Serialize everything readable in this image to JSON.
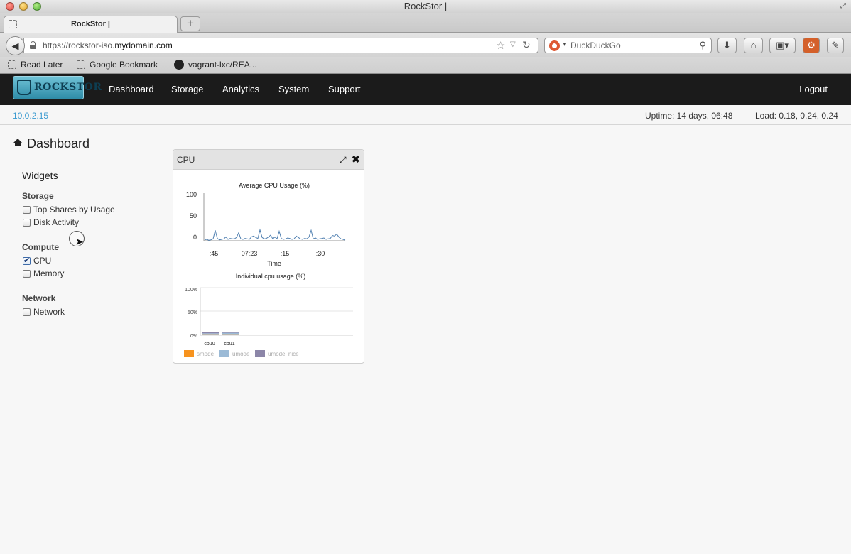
{
  "browser": {
    "window_title": "RockStor |",
    "tab_title": "RockStor |",
    "new_tab_label": "+",
    "url_prefix": "https://rockstor-iso.",
    "url_domain": "mydomain.com",
    "search_placeholder": "DuckDuckGo",
    "bookmarks": [
      "Read Later",
      "Google Bookmark",
      "vagrant-lxc/REA..."
    ]
  },
  "app": {
    "logo_text": "ROCKSTOR",
    "nav": [
      "Dashboard",
      "Storage",
      "Analytics",
      "System",
      "Support"
    ],
    "logout": "Logout",
    "ip": "10.0.2.15",
    "uptime": "Uptime: 14 days, 06:48",
    "load": "Load: 0.18, 0.24, 0.24"
  },
  "sidebar": {
    "title": "Dashboard",
    "widgets_heading": "Widgets",
    "groups": [
      {
        "name": "Storage",
        "items": [
          {
            "label": "Top Shares by Usage",
            "checked": false
          },
          {
            "label": "Disk Activity",
            "checked": false
          }
        ]
      },
      {
        "name": "Compute",
        "items": [
          {
            "label": "CPU",
            "checked": true
          },
          {
            "label": "Memory",
            "checked": false
          }
        ]
      },
      {
        "name": "Network",
        "items": [
          {
            "label": "Network",
            "checked": false
          }
        ]
      }
    ]
  },
  "widget": {
    "title": "CPU"
  },
  "colors": {
    "line": "#4f7fb0",
    "smode": "#f7931e",
    "umode": "#9bbad6",
    "umode_nice": "#8c86a8"
  },
  "chart_data": [
    {
      "type": "line",
      "title": "Average CPU Usage (%)",
      "xlabel": "Time",
      "ylabel": "",
      "ylim": [
        0,
        100
      ],
      "yticks": [
        "100",
        "50",
        "0"
      ],
      "x_ticks": [
        ":45",
        "07:23",
        ":15",
        ":30"
      ],
      "values": [
        2,
        3,
        1,
        2,
        4,
        22,
        5,
        2,
        3,
        4,
        8,
        3,
        5,
        4,
        4,
        7,
        17,
        4,
        3,
        5,
        4,
        3,
        8,
        10,
        7,
        5,
        23,
        7,
        4,
        5,
        8,
        12,
        4,
        8,
        4,
        20,
        5,
        3,
        4,
        6,
        5,
        3,
        4,
        10,
        7,
        4,
        3,
        5,
        4,
        8,
        22,
        4,
        6,
        3,
        4,
        5,
        6,
        3,
        4,
        5,
        11,
        10,
        14,
        8,
        4,
        3,
        1
      ],
      "grid": false,
      "legend": "none"
    },
    {
      "type": "bar",
      "title": "Individual cpu usage (%)",
      "categories": [
        "cpu0",
        "cpu1"
      ],
      "yticks": [
        "100%",
        "50%",
        "0%"
      ],
      "ylim": [
        0,
        100
      ],
      "series": [
        {
          "name": "smode",
          "values": [
            2,
            2
          ]
        },
        {
          "name": "umode",
          "values": [
            2,
            3
          ]
        },
        {
          "name": "umode_nice",
          "values": [
            2,
            2
          ]
        }
      ],
      "stacked": true,
      "legend": "bottom"
    }
  ]
}
